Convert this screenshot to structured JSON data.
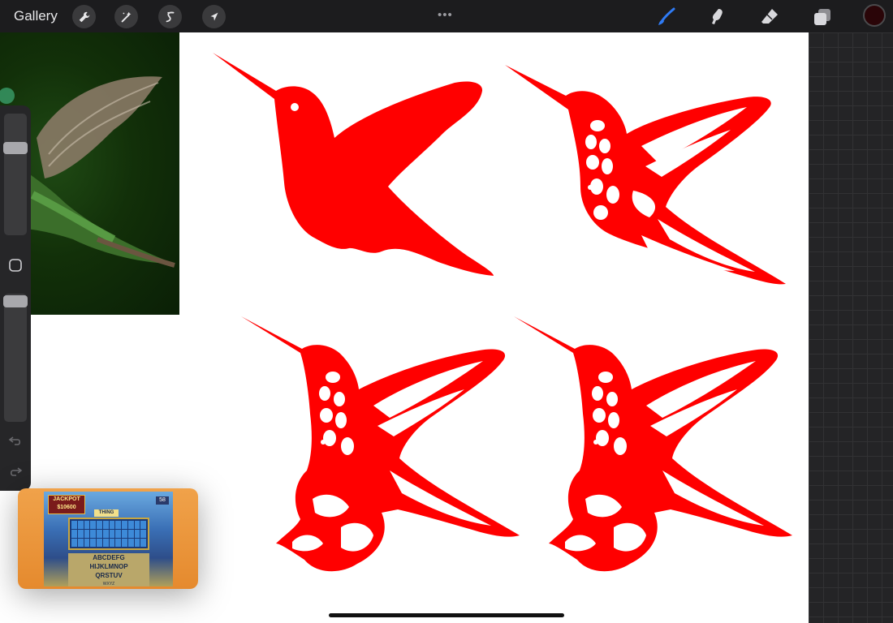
{
  "app": {
    "gallery_label": "Gallery"
  },
  "toolbar": {
    "left_tools": [
      {
        "name": "actions",
        "icon": "wrench-icon"
      },
      {
        "name": "adjustments",
        "icon": "magic-wand-icon"
      },
      {
        "name": "selection",
        "icon": "selection-s-icon"
      },
      {
        "name": "transform",
        "icon": "arrow-cursor-icon"
      }
    ],
    "more_label": "•••",
    "right_tools": [
      {
        "name": "brush",
        "icon": "brush-icon",
        "active": true,
        "color": "#2f7bf5"
      },
      {
        "name": "smudge",
        "icon": "smudge-icon"
      },
      {
        "name": "eraser",
        "icon": "eraser-icon"
      },
      {
        "name": "layers",
        "icon": "layers-icon"
      }
    ],
    "current_color": "#2a0508"
  },
  "canvas": {
    "art_color": "#ff0000",
    "background": "#ffffff"
  },
  "sidebar": {
    "brush_size_level": 0.85,
    "opacity_level": 1.0
  },
  "pip": {
    "jackpot_label": "JACKPOT",
    "jackpot_value": "$10600",
    "round_label": "58",
    "category_label": "THING",
    "letters_line1": "ABCDEFG",
    "letters_line2": "HIJKLMNOP",
    "letters_line3": "QRSTUV",
    "letters_line4": "WXYZ"
  }
}
